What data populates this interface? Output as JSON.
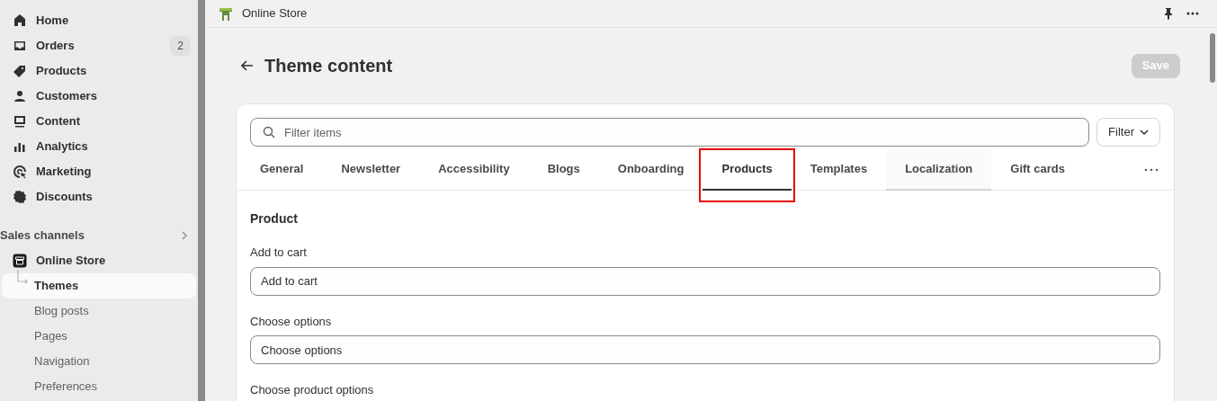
{
  "sidebar": {
    "items": [
      {
        "label": "Home",
        "selected": false
      },
      {
        "label": "Orders",
        "badge": "2",
        "selected": false
      },
      {
        "label": "Products",
        "selected": false
      },
      {
        "label": "Customers",
        "selected": false
      },
      {
        "label": "Content",
        "selected": false
      },
      {
        "label": "Analytics",
        "selected": false
      },
      {
        "label": "Marketing",
        "selected": false
      },
      {
        "label": "Discounts",
        "selected": false
      }
    ],
    "sales_channels": {
      "label": "Sales channels",
      "channel": {
        "label": "Online Store",
        "children": [
          {
            "label": "Themes",
            "selected": true
          },
          {
            "label": "Blog posts",
            "selected": false
          },
          {
            "label": "Pages",
            "selected": false
          },
          {
            "label": "Navigation",
            "selected": false
          },
          {
            "label": "Preferences",
            "selected": false
          }
        ]
      }
    }
  },
  "top_bar": {
    "title": "Online Store"
  },
  "page": {
    "title": "Theme content",
    "save_button": {
      "label": "Save",
      "disabled": true
    }
  },
  "search": {
    "placeholder": "Filter items"
  },
  "filter_button": {
    "label": "Filter"
  },
  "tabs": [
    {
      "label": "General",
      "selected": false,
      "hovered": false,
      "highlighted": false
    },
    {
      "label": "Newsletter",
      "selected": false,
      "hovered": false,
      "highlighted": false
    },
    {
      "label": "Accessibility",
      "selected": false,
      "hovered": false,
      "highlighted": false
    },
    {
      "label": "Blogs",
      "selected": false,
      "hovered": false,
      "highlighted": false
    },
    {
      "label": "Onboarding",
      "selected": false,
      "hovered": false,
      "highlighted": false
    },
    {
      "label": "Products",
      "selected": true,
      "hovered": false,
      "highlighted": true
    },
    {
      "label": "Templates",
      "selected": false,
      "hovered": false,
      "highlighted": false
    },
    {
      "label": "Localization",
      "selected": false,
      "hovered": true,
      "highlighted": false
    },
    {
      "label": "Gift cards",
      "selected": false,
      "hovered": false,
      "highlighted": false
    }
  ],
  "section": {
    "title": "Product",
    "fields": [
      {
        "label": "Add to cart",
        "value": "Add to cart"
      },
      {
        "label": "Choose options",
        "value": "Choose options"
      },
      {
        "label": "Choose product options"
      }
    ]
  }
}
